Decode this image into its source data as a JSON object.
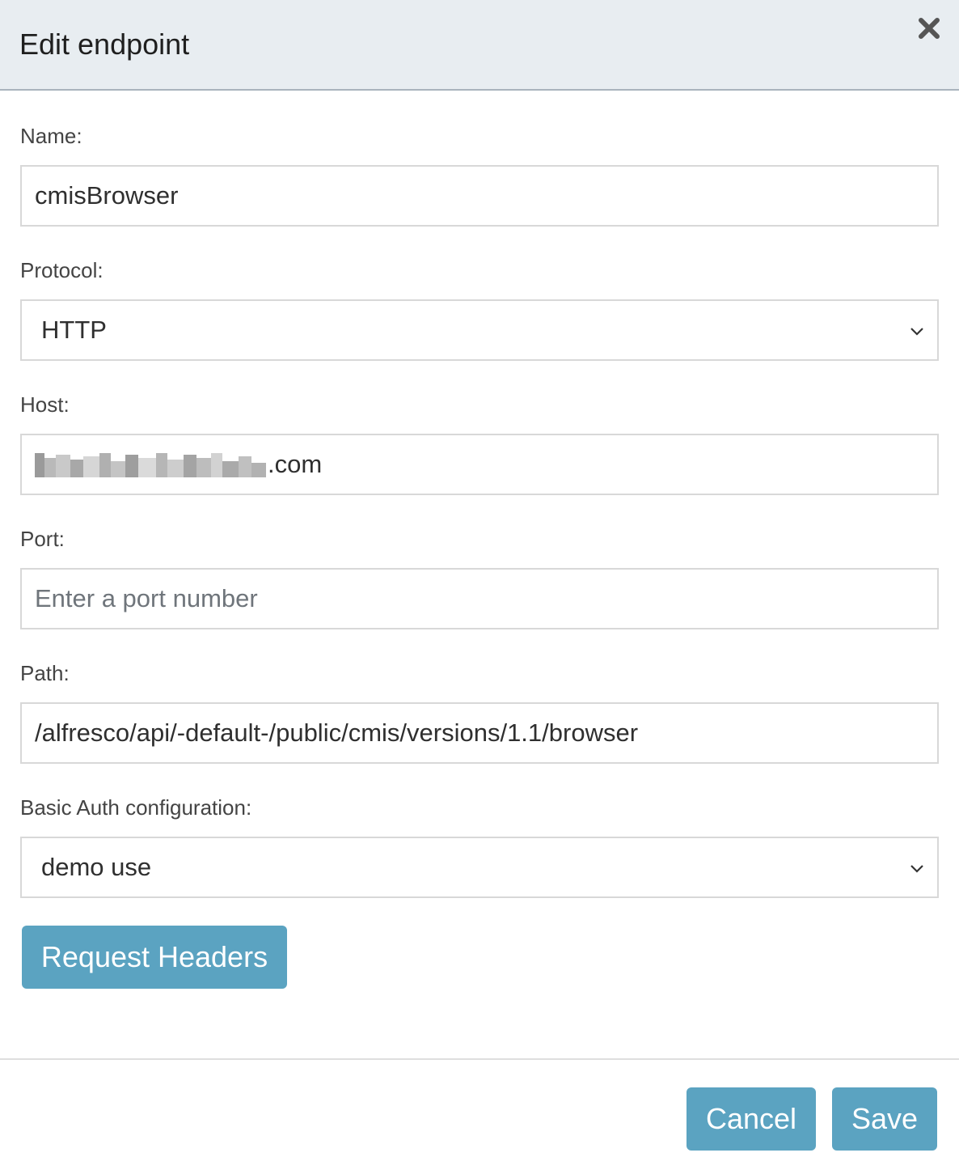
{
  "header": {
    "title": "Edit endpoint",
    "close_icon": "close-icon"
  },
  "form": {
    "name": {
      "label": "Name:",
      "value": "cmisBrowser"
    },
    "protocol": {
      "label": "Protocol:",
      "value": "HTTP",
      "icon": "chevron-down-icon"
    },
    "host": {
      "label": "Host:",
      "visible_suffix": ".com",
      "redacted": true
    },
    "port": {
      "label": "Port:",
      "value": "",
      "placeholder": "Enter a port number"
    },
    "path": {
      "label": "Path:",
      "value": "/alfresco/api/-default-/public/cmis/versions/1.1/browser"
    },
    "basic_auth": {
      "label": "Basic Auth configuration:",
      "value": "demo use",
      "icon": "chevron-down-icon"
    },
    "request_headers_label": "Request Headers"
  },
  "footer": {
    "cancel_label": "Cancel",
    "save_label": "Save"
  },
  "colors": {
    "header_bg": "#e8edf1",
    "button_bg": "#5ba3c1",
    "input_border": "#d8d8d8"
  }
}
